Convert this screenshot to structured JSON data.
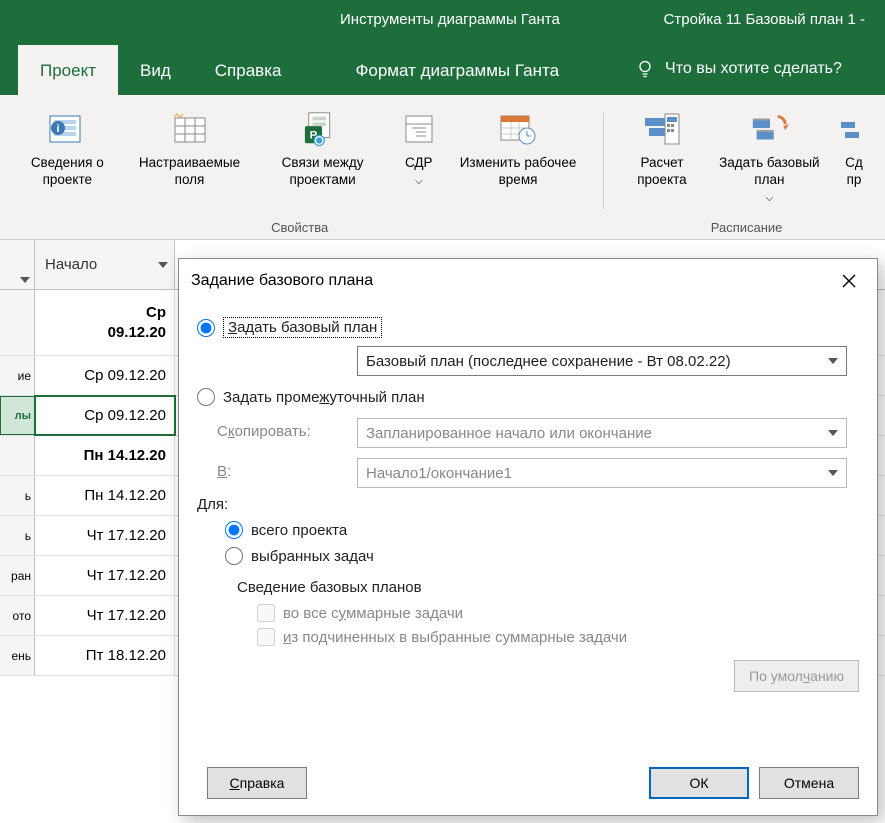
{
  "titlebar": {
    "context_title": "Инструменты диаграммы Ганта",
    "file_title": "Стройка 11 Базовый план 1 -"
  },
  "tabs": {
    "project": "Проект",
    "view": "Вид",
    "help": "Справка",
    "context": "Формат диаграммы Ганта",
    "tellme": "Что вы хотите сделать?"
  },
  "ribbon": {
    "info": "Сведения о проекте",
    "custom_fields": "Настраиваемые поля",
    "links": "Связи между проектами",
    "wbs": "СДР",
    "change_time": "Изменить рабочее время",
    "calc": "Расчет проекта",
    "baseline": "Задать базовый план",
    "shift": "Сд\nпр",
    "group_props": "Свойства",
    "group_sched": "Расписание"
  },
  "sheet": {
    "col_start": "Начало",
    "rows": [
      {
        "hdr": "",
        "val1": "Ср",
        "val2": "09.12.20",
        "bold": true,
        "double": true
      },
      {
        "hdr": "ие",
        "val": "Ср 09.12.20"
      },
      {
        "hdr": "лы",
        "val": "Ср 09.12.20",
        "selected": true
      },
      {
        "hdr": "",
        "val": "Пн 14.12.20",
        "bold": true
      },
      {
        "hdr": "ь",
        "val": "Пн 14.12.20"
      },
      {
        "hdr": "ь",
        "val": "Чт 17.12.20"
      },
      {
        "hdr": "ран",
        "val": "Чт 17.12.20"
      },
      {
        "hdr": "ото",
        "val": "Чт 17.12.20"
      },
      {
        "hdr": "ень",
        "val": "Пт 18.12.20"
      }
    ]
  },
  "dialog": {
    "title": "Задание базового плана",
    "opt_baseline": "Задать базовый план",
    "baseline_select": "Базовый план (последнее сохранение - Вт 08.02.22)",
    "opt_interim": "Задать промежуточный план",
    "copy_lbl": "Скопировать:",
    "copy_val": "Запланированное начало или окончание",
    "into_lbl": "В:",
    "into_val": "Начало1/окончание1",
    "for_lbl": "Для:",
    "for_all": "всего проекта",
    "for_selected": "выбранных задач",
    "summary_lbl": "Сведение базовых планов",
    "chk_all_summary": "во все суммарные задачи",
    "chk_from_sub": "из подчиненных в выбранные суммарные задачи",
    "btn_default": "По умолчанию",
    "btn_help": "Справка",
    "btn_ok": "ОК",
    "btn_cancel": "Отмена"
  }
}
